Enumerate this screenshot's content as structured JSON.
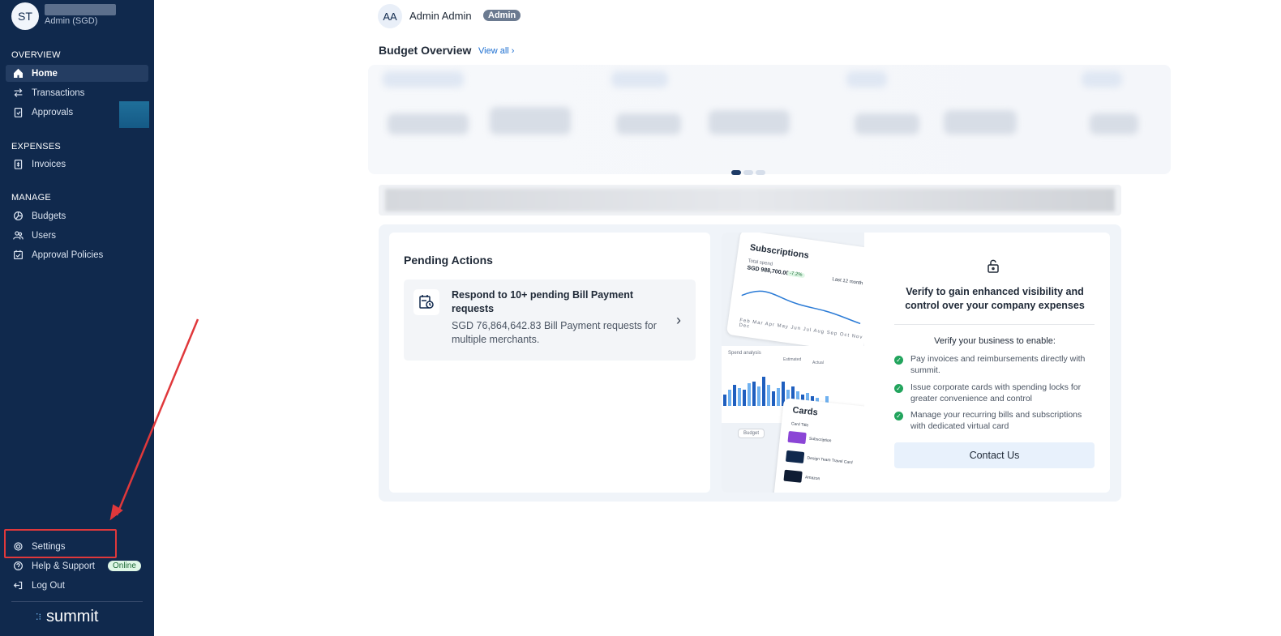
{
  "sidebar": {
    "avatar_initials": "ST",
    "role": "Admin (SGD)",
    "sections": {
      "overview": "OVERVIEW",
      "expenses": "EXPENSES",
      "manage": "MANAGE"
    },
    "items": {
      "home": "Home",
      "transactions": "Transactions",
      "approvals": "Approvals",
      "invoices": "Invoices",
      "budgets": "Budgets",
      "users": "Users",
      "approval_policies": "Approval Policies",
      "settings": "Settings",
      "help_support": "Help & Support",
      "online_badge": "Online",
      "log_out": "Log Out"
    },
    "logo_text": "summit"
  },
  "header": {
    "user_initials": "AA",
    "user_name": "Admin Admin",
    "user_role_badge": "Admin"
  },
  "budget_overview": {
    "title": "Budget Overview",
    "view_all": "View all"
  },
  "pending_actions": {
    "title": "Pending Actions",
    "action_title": "Respond to 10+ pending Bill Payment requests",
    "action_description": "SGD 76,864,642.83 Bill Payment requests for multiple merchants."
  },
  "mockup": {
    "subscriptions_title": "Subscriptions",
    "total_spend_label": "Total spend",
    "total_spend_value": "SGD 988,700.00",
    "change_pct": "-7.2%",
    "range": "Last 12 month",
    "months": "Feb Mar Apr May Jun Jul Aug Sep Oct Nov Dec",
    "spend_analysis": "Spend analysis",
    "estimated": "Estimated",
    "actual": "Actual",
    "cards_title": "Cards",
    "card_title_col": "Card Title",
    "card1": "Subscription",
    "card2": "Design Team Travel Card",
    "card3": "Amazon",
    "budget_tab": "Budget"
  },
  "verify": {
    "title": "Verify to gain enhanced visibility and control over your company expenses",
    "subtitle": "Verify your business to enable:",
    "benefits": [
      "Pay invoices and reimbursements directly with summit.",
      "Issue corporate cards with spending locks for greater convenience and control",
      "Manage your recurring bills and subscriptions with dedicated virtual card"
    ],
    "contact_button": "Contact Us"
  },
  "colors": {
    "sidebar_bg": "#10294d",
    "accent_link": "#1d6fd1",
    "highlight_red": "#e0383b",
    "check_green": "#22a45d"
  }
}
